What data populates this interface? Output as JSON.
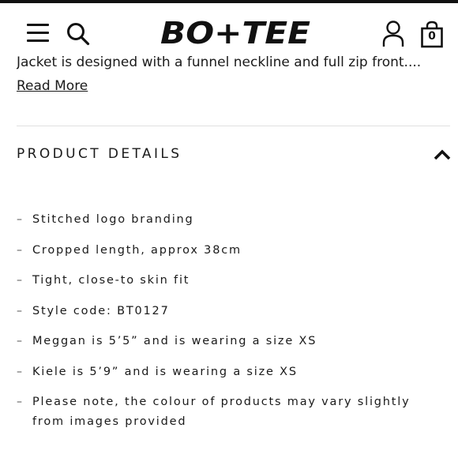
{
  "header": {
    "logo_text": "BO+TEE",
    "menu_icon": "hamburger-icon",
    "search_icon": "search-icon",
    "account_icon": "user-icon",
    "bag_icon": "shopping-bag-icon",
    "bag_count": "0"
  },
  "description": {
    "text": "Jacket is designed with a funnel neckline and full zip front....",
    "read_more_label": "Read More"
  },
  "product_details": {
    "title": "PRODUCT DETAILS",
    "toggle_icon": "chevron-up-icon",
    "items": [
      {
        "text": "Stitched logo branding"
      },
      {
        "text": "Cropped length, approx 38cm"
      },
      {
        "text": "Tight, close-to skin fit"
      },
      {
        "text": "Style code: BT0127"
      },
      {
        "text": "Meggan is 5’5” and is wearing a size XS"
      },
      {
        "text": "Kiele is 5’9” and is wearing a size XS"
      },
      {
        "text": "Please note, the colour of products may vary slightly from images provided"
      }
    ]
  },
  "colors": {
    "text": "#1a1a1a",
    "divider": "#e0e0e0",
    "background": "#ffffff"
  }
}
